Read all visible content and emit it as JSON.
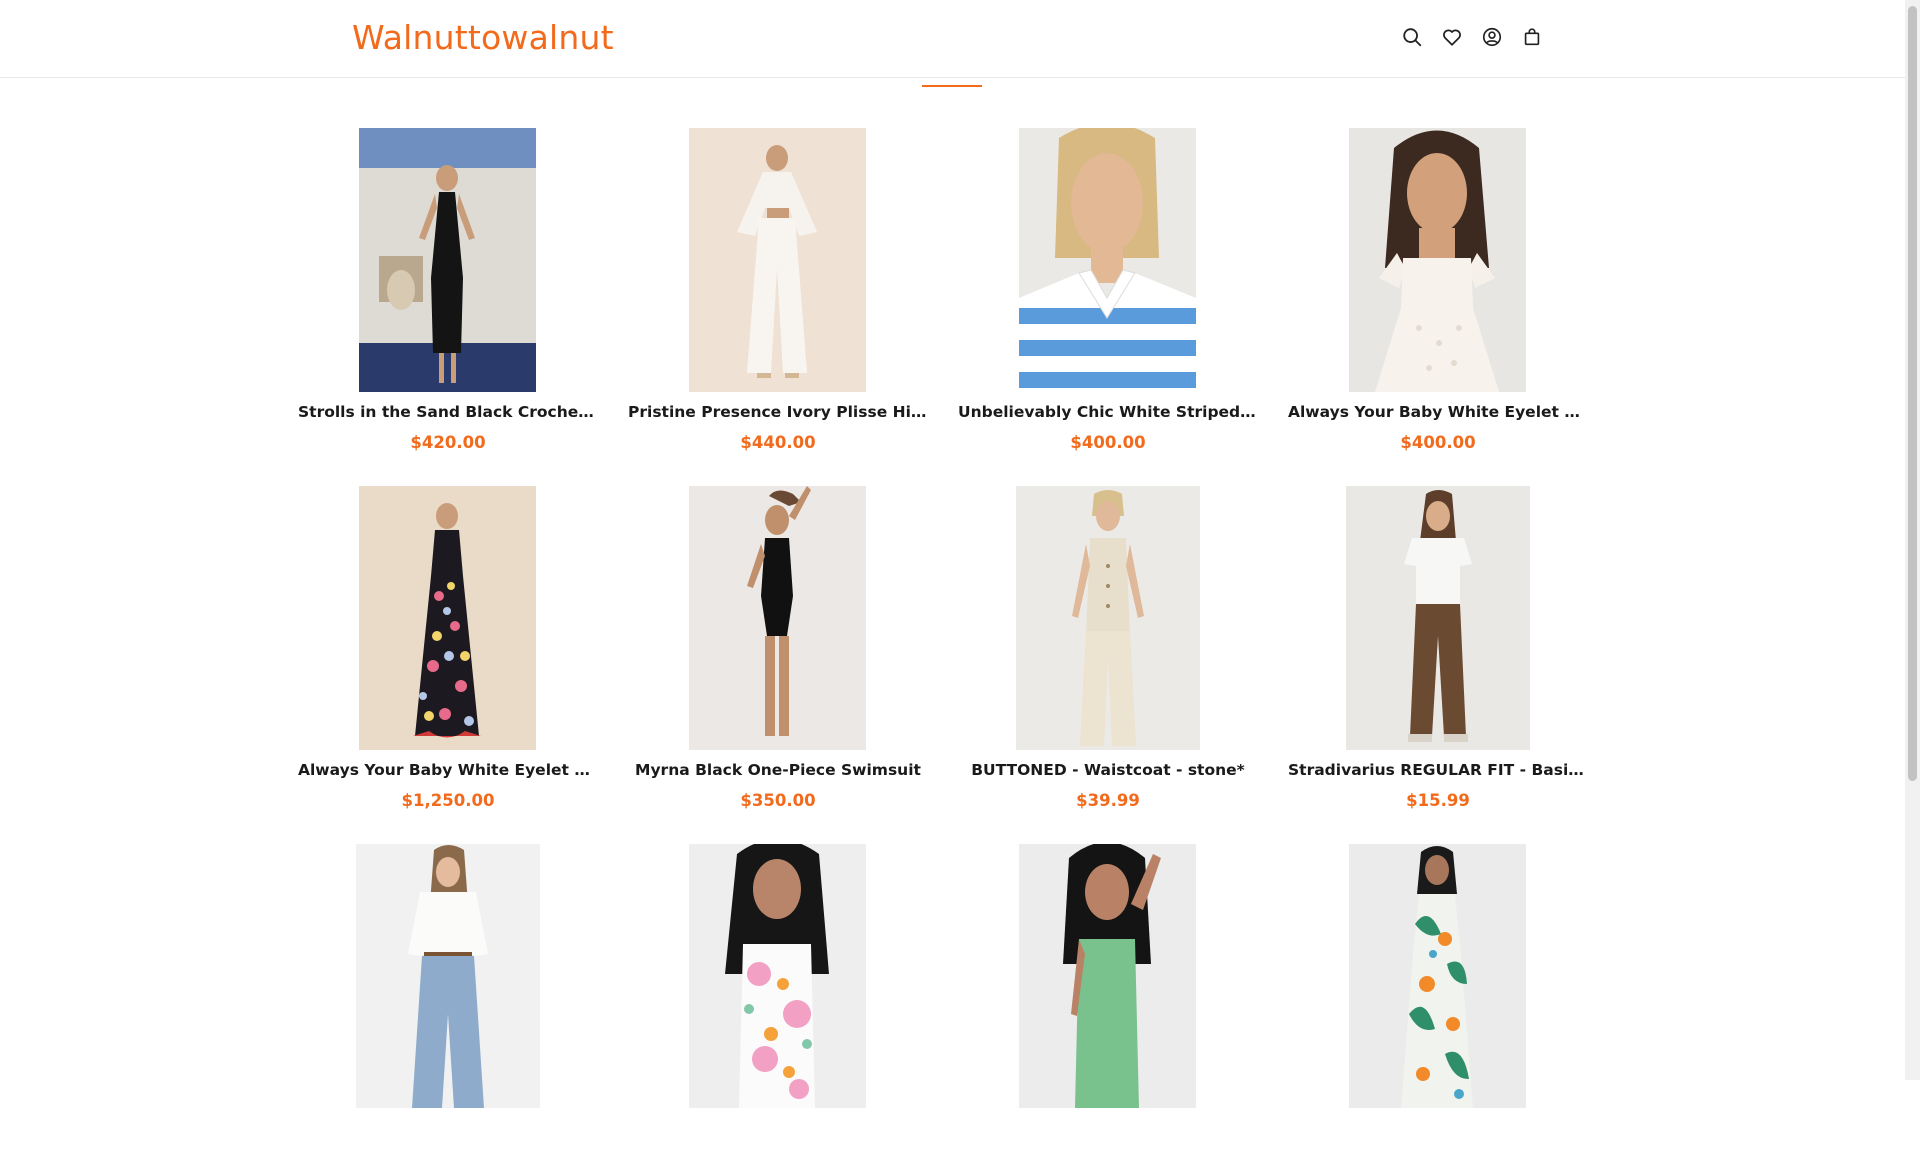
{
  "header": {
    "logo": "Walnuttowalnut",
    "icons": [
      "search-icon",
      "heart-icon",
      "account-icon",
      "bag-icon"
    ]
  },
  "colors": {
    "accent": "#f26b1d"
  },
  "products": [
    {
      "name": "Strolls in the Sand Black Crochet Midi Dress",
      "price": "$420.00"
    },
    {
      "name": "Pristine Presence Ivory Plisse High-Waisted Pants",
      "price": "$440.00"
    },
    {
      "name": "Unbelievably Chic White Striped Collared Top",
      "price": "$400.00"
    },
    {
      "name": "Always Your Baby White Eyelet Babydoll Top",
      "price": "$400.00"
    },
    {
      "name": "Always Your Baby White Eyelet Babydoll Dress",
      "price": "$1,250.00"
    },
    {
      "name": "Myrna Black One-Piece Swimsuit",
      "price": "$350.00"
    },
    {
      "name": "BUTTONED - Waistcoat - stone*",
      "price": "$39.99"
    },
    {
      "name": "Stradivarius REGULAR FIT - Basic T-shirt",
      "price": "$15.99"
    },
    {
      "name": "",
      "price": ""
    },
    {
      "name": "",
      "price": ""
    },
    {
      "name": "",
      "price": ""
    },
    {
      "name": "",
      "price": ""
    }
  ]
}
